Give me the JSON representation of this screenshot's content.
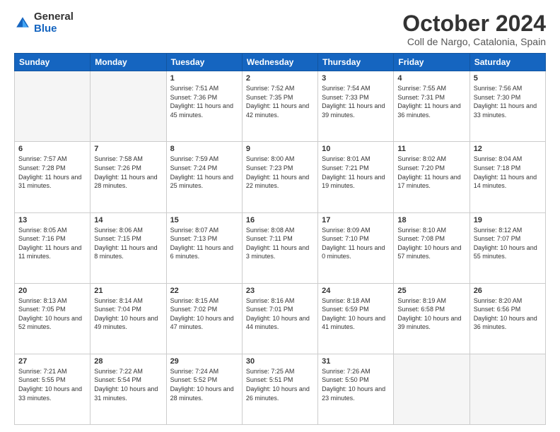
{
  "header": {
    "logo_general": "General",
    "logo_blue": "Blue",
    "month_title": "October 2024",
    "location": "Coll de Nargo, Catalonia, Spain"
  },
  "weekdays": [
    "Sunday",
    "Monday",
    "Tuesday",
    "Wednesday",
    "Thursday",
    "Friday",
    "Saturday"
  ],
  "weeks": [
    [
      {
        "day": "",
        "sunrise": "",
        "sunset": "",
        "daylight": ""
      },
      {
        "day": "",
        "sunrise": "",
        "sunset": "",
        "daylight": ""
      },
      {
        "day": "1",
        "sunrise": "Sunrise: 7:51 AM",
        "sunset": "Sunset: 7:36 PM",
        "daylight": "Daylight: 11 hours and 45 minutes."
      },
      {
        "day": "2",
        "sunrise": "Sunrise: 7:52 AM",
        "sunset": "Sunset: 7:35 PM",
        "daylight": "Daylight: 11 hours and 42 minutes."
      },
      {
        "day": "3",
        "sunrise": "Sunrise: 7:54 AM",
        "sunset": "Sunset: 7:33 PM",
        "daylight": "Daylight: 11 hours and 39 minutes."
      },
      {
        "day": "4",
        "sunrise": "Sunrise: 7:55 AM",
        "sunset": "Sunset: 7:31 PM",
        "daylight": "Daylight: 11 hours and 36 minutes."
      },
      {
        "day": "5",
        "sunrise": "Sunrise: 7:56 AM",
        "sunset": "Sunset: 7:30 PM",
        "daylight": "Daylight: 11 hours and 33 minutes."
      }
    ],
    [
      {
        "day": "6",
        "sunrise": "Sunrise: 7:57 AM",
        "sunset": "Sunset: 7:28 PM",
        "daylight": "Daylight: 11 hours and 31 minutes."
      },
      {
        "day": "7",
        "sunrise": "Sunrise: 7:58 AM",
        "sunset": "Sunset: 7:26 PM",
        "daylight": "Daylight: 11 hours and 28 minutes."
      },
      {
        "day": "8",
        "sunrise": "Sunrise: 7:59 AM",
        "sunset": "Sunset: 7:24 PM",
        "daylight": "Daylight: 11 hours and 25 minutes."
      },
      {
        "day": "9",
        "sunrise": "Sunrise: 8:00 AM",
        "sunset": "Sunset: 7:23 PM",
        "daylight": "Daylight: 11 hours and 22 minutes."
      },
      {
        "day": "10",
        "sunrise": "Sunrise: 8:01 AM",
        "sunset": "Sunset: 7:21 PM",
        "daylight": "Daylight: 11 hours and 19 minutes."
      },
      {
        "day": "11",
        "sunrise": "Sunrise: 8:02 AM",
        "sunset": "Sunset: 7:20 PM",
        "daylight": "Daylight: 11 hours and 17 minutes."
      },
      {
        "day": "12",
        "sunrise": "Sunrise: 8:04 AM",
        "sunset": "Sunset: 7:18 PM",
        "daylight": "Daylight: 11 hours and 14 minutes."
      }
    ],
    [
      {
        "day": "13",
        "sunrise": "Sunrise: 8:05 AM",
        "sunset": "Sunset: 7:16 PM",
        "daylight": "Daylight: 11 hours and 11 minutes."
      },
      {
        "day": "14",
        "sunrise": "Sunrise: 8:06 AM",
        "sunset": "Sunset: 7:15 PM",
        "daylight": "Daylight: 11 hours and 8 minutes."
      },
      {
        "day": "15",
        "sunrise": "Sunrise: 8:07 AM",
        "sunset": "Sunset: 7:13 PM",
        "daylight": "Daylight: 11 hours and 6 minutes."
      },
      {
        "day": "16",
        "sunrise": "Sunrise: 8:08 AM",
        "sunset": "Sunset: 7:11 PM",
        "daylight": "Daylight: 11 hours and 3 minutes."
      },
      {
        "day": "17",
        "sunrise": "Sunrise: 8:09 AM",
        "sunset": "Sunset: 7:10 PM",
        "daylight": "Daylight: 11 hours and 0 minutes."
      },
      {
        "day": "18",
        "sunrise": "Sunrise: 8:10 AM",
        "sunset": "Sunset: 7:08 PM",
        "daylight": "Daylight: 10 hours and 57 minutes."
      },
      {
        "day": "19",
        "sunrise": "Sunrise: 8:12 AM",
        "sunset": "Sunset: 7:07 PM",
        "daylight": "Daylight: 10 hours and 55 minutes."
      }
    ],
    [
      {
        "day": "20",
        "sunrise": "Sunrise: 8:13 AM",
        "sunset": "Sunset: 7:05 PM",
        "daylight": "Daylight: 10 hours and 52 minutes."
      },
      {
        "day": "21",
        "sunrise": "Sunrise: 8:14 AM",
        "sunset": "Sunset: 7:04 PM",
        "daylight": "Daylight: 10 hours and 49 minutes."
      },
      {
        "day": "22",
        "sunrise": "Sunrise: 8:15 AM",
        "sunset": "Sunset: 7:02 PM",
        "daylight": "Daylight: 10 hours and 47 minutes."
      },
      {
        "day": "23",
        "sunrise": "Sunrise: 8:16 AM",
        "sunset": "Sunset: 7:01 PM",
        "daylight": "Daylight: 10 hours and 44 minutes."
      },
      {
        "day": "24",
        "sunrise": "Sunrise: 8:18 AM",
        "sunset": "Sunset: 6:59 PM",
        "daylight": "Daylight: 10 hours and 41 minutes."
      },
      {
        "day": "25",
        "sunrise": "Sunrise: 8:19 AM",
        "sunset": "Sunset: 6:58 PM",
        "daylight": "Daylight: 10 hours and 39 minutes."
      },
      {
        "day": "26",
        "sunrise": "Sunrise: 8:20 AM",
        "sunset": "Sunset: 6:56 PM",
        "daylight": "Daylight: 10 hours and 36 minutes."
      }
    ],
    [
      {
        "day": "27",
        "sunrise": "Sunrise: 7:21 AM",
        "sunset": "Sunset: 5:55 PM",
        "daylight": "Daylight: 10 hours and 33 minutes."
      },
      {
        "day": "28",
        "sunrise": "Sunrise: 7:22 AM",
        "sunset": "Sunset: 5:54 PM",
        "daylight": "Daylight: 10 hours and 31 minutes."
      },
      {
        "day": "29",
        "sunrise": "Sunrise: 7:24 AM",
        "sunset": "Sunset: 5:52 PM",
        "daylight": "Daylight: 10 hours and 28 minutes."
      },
      {
        "day": "30",
        "sunrise": "Sunrise: 7:25 AM",
        "sunset": "Sunset: 5:51 PM",
        "daylight": "Daylight: 10 hours and 26 minutes."
      },
      {
        "day": "31",
        "sunrise": "Sunrise: 7:26 AM",
        "sunset": "Sunset: 5:50 PM",
        "daylight": "Daylight: 10 hours and 23 minutes."
      },
      {
        "day": "",
        "sunrise": "",
        "sunset": "",
        "daylight": ""
      },
      {
        "day": "",
        "sunrise": "",
        "sunset": "",
        "daylight": ""
      }
    ]
  ]
}
